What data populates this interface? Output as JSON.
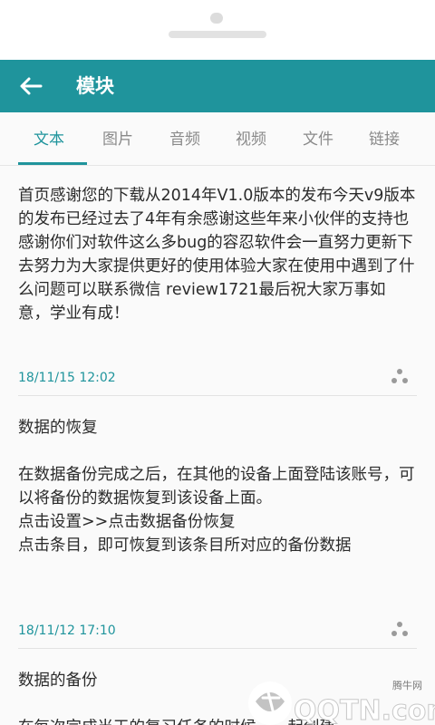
{
  "app_bar": {
    "title": "模块",
    "back_icon": "arrow-left-icon",
    "color": "#1f949c"
  },
  "tabs": [
    {
      "label": "文本",
      "active": true
    },
    {
      "label": "图片",
      "active": false
    },
    {
      "label": "音频",
      "active": false
    },
    {
      "label": "视频",
      "active": false
    },
    {
      "label": "文件",
      "active": false
    },
    {
      "label": "链接",
      "active": false
    }
  ],
  "notes": [
    {
      "body": "首页感谢您的下载从2014年V1.0版本的发布今天v9版本的发布已经过去了4年有余感谢这些年来小伙伴的支持也感谢你们对软件这么多bug的容忍软件会一直努力更新下去努力为大家提供更好的使用体验大家在使用中遇到了什么问题可以联系微信 review1721最后祝大家万事如意，学业有成！",
      "date": "18/11/15 12:02",
      "share_icon": "share-icon"
    },
    {
      "body": "数据的恢复\n\n在数据备份完成之后，在其他的设备上面登陆该账号，可以将备份的数据恢复到该设备上面。\n点击设置>>点击数据备份恢复\n点击条目，即可恢复到该条目所对应的备份数据",
      "date": "18/11/12 17:10",
      "share_icon": "share-icon"
    },
    {
      "body": "数据的备份\n\n在每次完成当天的复习任务的时候，一起创建",
      "date": "",
      "share_icon": "share-icon"
    }
  ],
  "watermark": {
    "cn": "腾牛网",
    "logo": "QQTN.com"
  }
}
